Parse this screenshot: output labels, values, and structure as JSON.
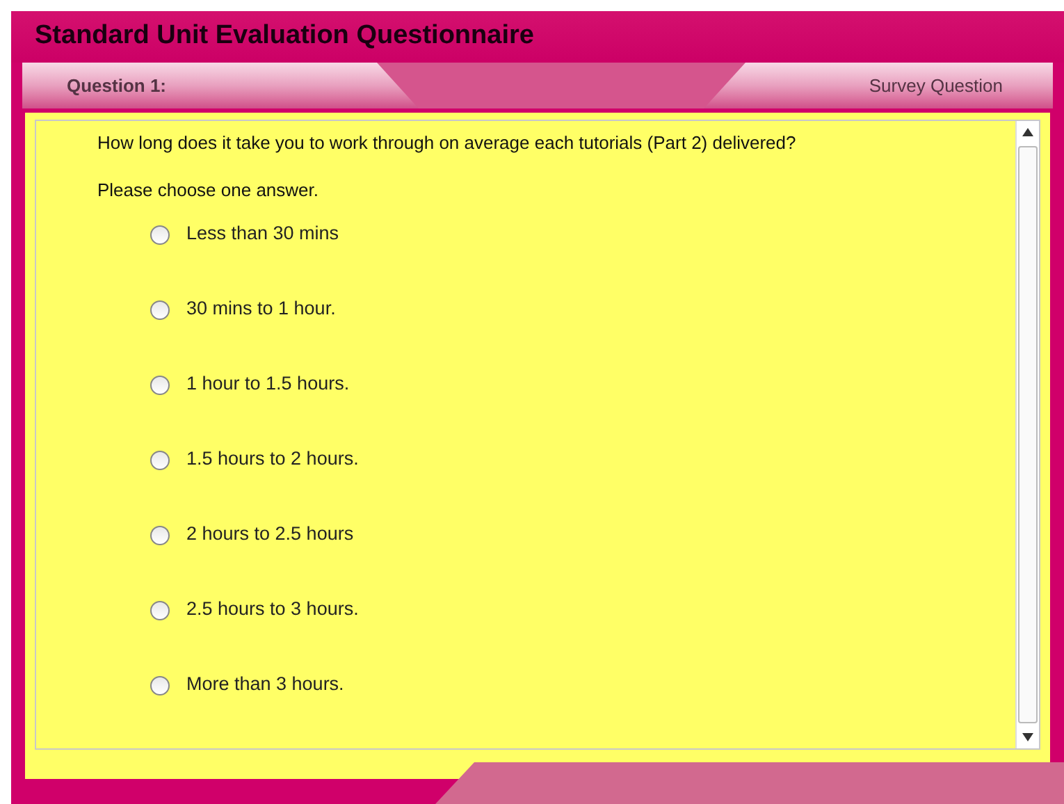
{
  "title": "Standard Unit Evaluation Questionnaire",
  "header": {
    "question_label": "Question 1:",
    "type_label": "Survey Question"
  },
  "question": {
    "text": "How long does it take you to work through on average each tutorials (Part 2) delivered?",
    "instruction": "Please choose one answer.",
    "options": [
      {
        "label": "Less than 30 mins",
        "selected": false
      },
      {
        "label": "30 mins to 1 hour.",
        "selected": false
      },
      {
        "label": "1 hour to 1.5 hours.",
        "selected": false
      },
      {
        "label": "1.5 hours to 2 hours.",
        "selected": false
      },
      {
        "label": "2 hours to 2.5 hours",
        "selected": false
      },
      {
        "label": "2.5 hours to 3 hours.",
        "selected": false
      },
      {
        "label": "More than 3 hours.",
        "selected": false
      }
    ]
  }
}
